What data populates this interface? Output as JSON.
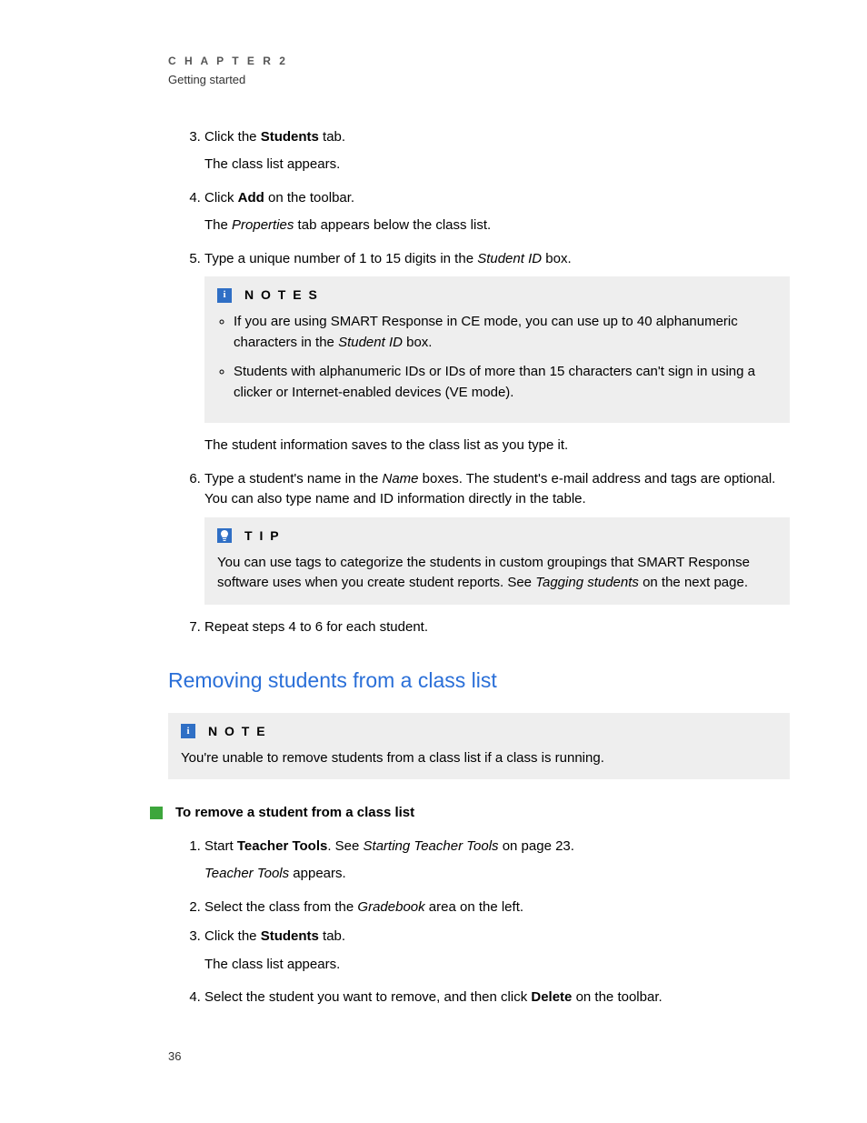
{
  "header": {
    "chapter": "C H A P T E R   2",
    "subtitle": "Getting started"
  },
  "stepsA": {
    "startNumber": "3",
    "3": {
      "prefix": "Click the ",
      "bold": "Students",
      "suffix": " tab.",
      "sub": "The class list appears."
    },
    "4": {
      "prefix": "Click ",
      "bold": "Add",
      "suffix": " on the toolbar.",
      "sub_prefix": "The ",
      "sub_italic": "Properties",
      "sub_suffix": " tab appears below the class list."
    },
    "5": {
      "prefix": "Type a unique number of 1 to 15 digits in the ",
      "italic": "Student ID",
      "suffix": " box."
    },
    "6": {
      "prefix": "Type a student's name in the ",
      "italic": "Name",
      "suffix": " boxes. The student's e-mail address and tags are optional. You can also type name and ID information directly in the table."
    },
    "7": {
      "text": "Repeat steps 4 to 6 for each student."
    }
  },
  "notesBox": {
    "title": "N O T E S",
    "item1_prefix": "If you are using SMART Response in CE mode, you can use up to 40 alphanumeric characters in the ",
    "item1_italic": "Student ID",
    "item1_suffix": " box.",
    "item2": "Students with alphanumeric IDs or IDs of more than 15 characters can't sign in using a clicker or Internet-enabled devices (VE mode)."
  },
  "afterNotes": "The student information saves to the class list as you type it.",
  "tipBox": {
    "title": "T I P",
    "text_prefix": "You can use tags to categorize the students in custom groupings that SMART Response software uses when you create student reports. See ",
    "text_italic": "Tagging students",
    "text_suffix": " on the next page."
  },
  "sectionHeading": "Removing students from a class list",
  "noteBox": {
    "title": "N O T E",
    "text": "You're unable to remove students from a class list if a class is running."
  },
  "taskHeading": "To remove a student from a class list",
  "stepsB": {
    "1": {
      "prefix": "Start ",
      "bold": "Teacher Tools",
      "mid": ". See ",
      "italic": "Starting Teacher Tools",
      "suffix": " on page 23.",
      "sub_italic": "Teacher Tools",
      "sub_suffix": " appears."
    },
    "2": {
      "prefix": "Select the class from the ",
      "italic": "Gradebook",
      "suffix": " area on the left."
    },
    "3": {
      "prefix": "Click the ",
      "bold": "Students",
      "suffix": " tab.",
      "sub": "The class list appears."
    },
    "4": {
      "prefix": "Select the student you want to remove, and then click ",
      "bold": "Delete",
      "suffix": " on the toolbar."
    }
  },
  "pageNumber": "36"
}
